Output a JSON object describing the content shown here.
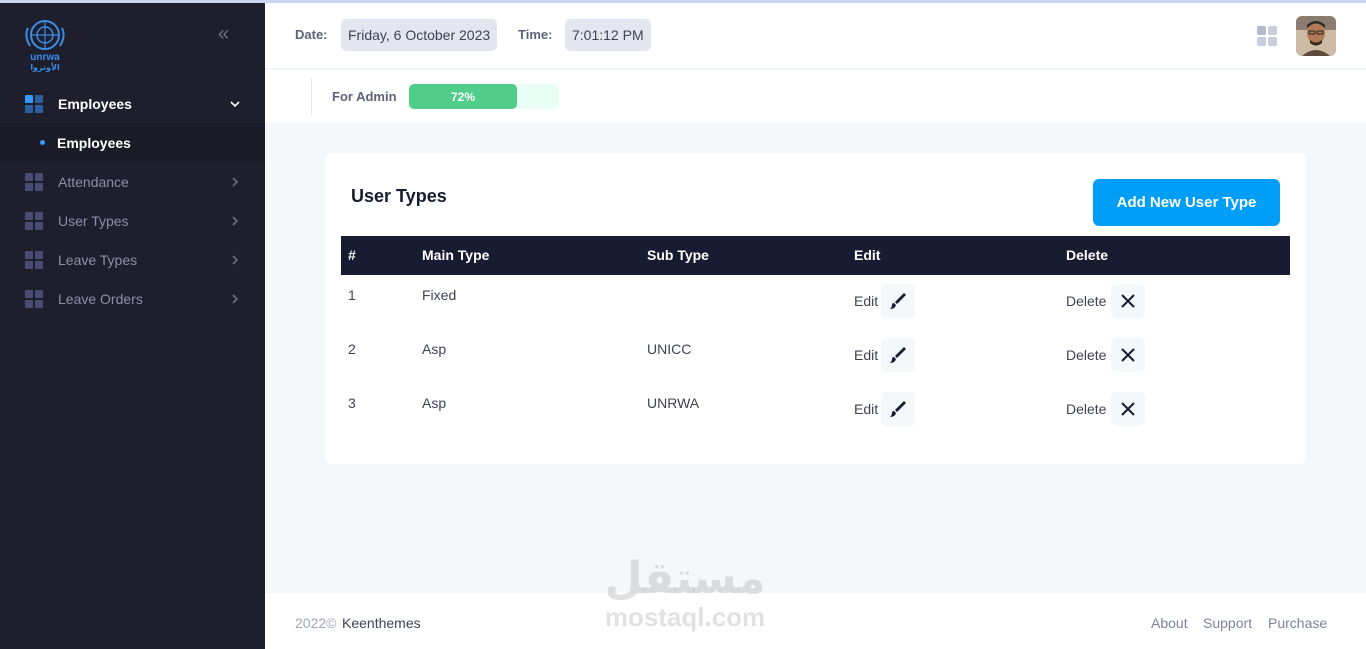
{
  "sidebar": {
    "logo": {
      "text": "unrwa",
      "arabic": "الأونروا"
    },
    "items": [
      {
        "label": "Employees",
        "active": true,
        "expanded": true,
        "children": [
          {
            "label": "Employees"
          }
        ]
      },
      {
        "label": "Attendance"
      },
      {
        "label": "User Types"
      },
      {
        "label": "Leave Types"
      },
      {
        "label": "Leave Orders"
      }
    ]
  },
  "header": {
    "date_label": "Date:",
    "date_value": "Friday, 6 October 2023",
    "time_label": "Time:",
    "time_value": "7:01:12 PM"
  },
  "subheader": {
    "label": "For Admin",
    "progress": {
      "value": 72,
      "text": "72%"
    }
  },
  "card": {
    "title": "User Types",
    "add_button": "Add New User Type",
    "columns": [
      "#",
      "Main Type",
      "Sub Type",
      "Edit",
      "Delete"
    ],
    "rows": [
      {
        "num": "1",
        "main": "Fixed",
        "sub": "",
        "edit": "Edit",
        "delete": "Delete"
      },
      {
        "num": "2",
        "main": "Asp",
        "sub": "UNICC",
        "edit": "Edit",
        "delete": "Delete"
      },
      {
        "num": "3",
        "main": "Asp",
        "sub": "UNRWA",
        "edit": "Edit",
        "delete": "Delete"
      }
    ]
  },
  "footer": {
    "year": "2022©",
    "brand": "Keenthemes",
    "links": [
      "About",
      "Support",
      "Purchase"
    ]
  },
  "watermark": {
    "arabic": "مستقل",
    "latin": "mostaql.com"
  },
  "colors": {
    "sidebar_bg": "#1e1e2d",
    "accent": "#009ef7",
    "progress": "#50cd89",
    "table_header": "#181c32"
  }
}
